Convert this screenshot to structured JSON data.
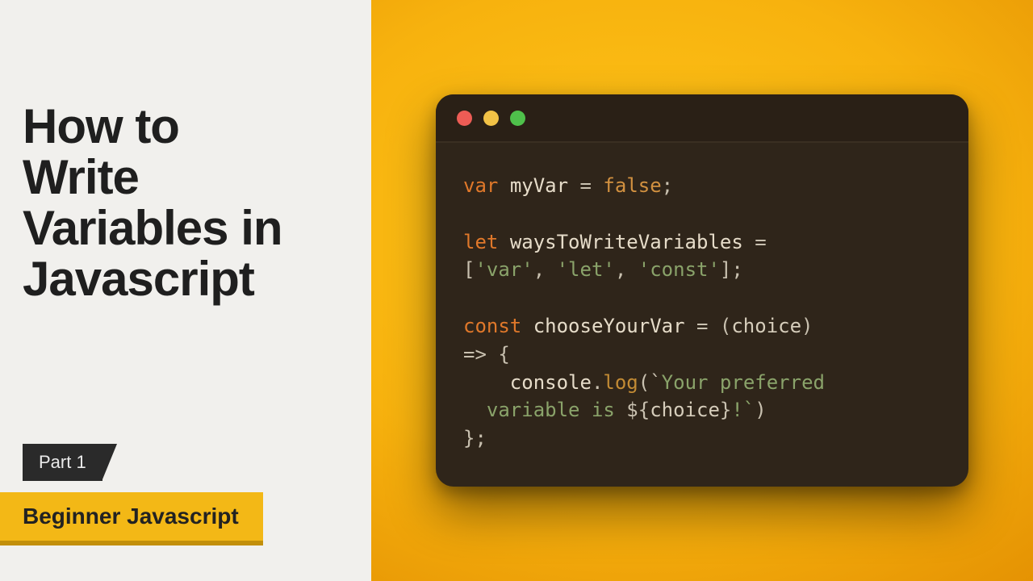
{
  "left": {
    "title_lines": [
      "How to",
      "Write",
      "Variables in",
      "Javascript"
    ],
    "part_label": "Part 1",
    "course_label": "Beginner Javascript"
  },
  "code": {
    "line1": {
      "kw": "var",
      "ident": "myVar",
      "op1": " = ",
      "bool": "false",
      "semi": ";"
    },
    "line2": {
      "kw": "let",
      "ident": "waysToWriteVariables",
      "op1": " ="
    },
    "line3": {
      "open": "[",
      "s1": "'var'",
      "c1": ", ",
      "s2": "'let'",
      "c2": ", ",
      "s3": "'const'",
      "close": "];"
    },
    "line4": {
      "kw": "const",
      "ident": "chooseYourVar",
      "op1": " = (",
      "param": "choice",
      "op2": ")"
    },
    "line5": {
      "arrow": "=> {"
    },
    "line6": {
      "indent": "    ",
      "obj": "console",
      "dot": ".",
      "method": "log",
      "open": "(`",
      "tmpl1": "Your preferred"
    },
    "line7": {
      "indent": "  ",
      "tmpl2": "variable is ",
      "iopen": "${",
      "ivar": "choice",
      "iclose": "}",
      "tmpl3": "!`",
      "close": ")"
    },
    "line8": {
      "brace": "};"
    }
  }
}
